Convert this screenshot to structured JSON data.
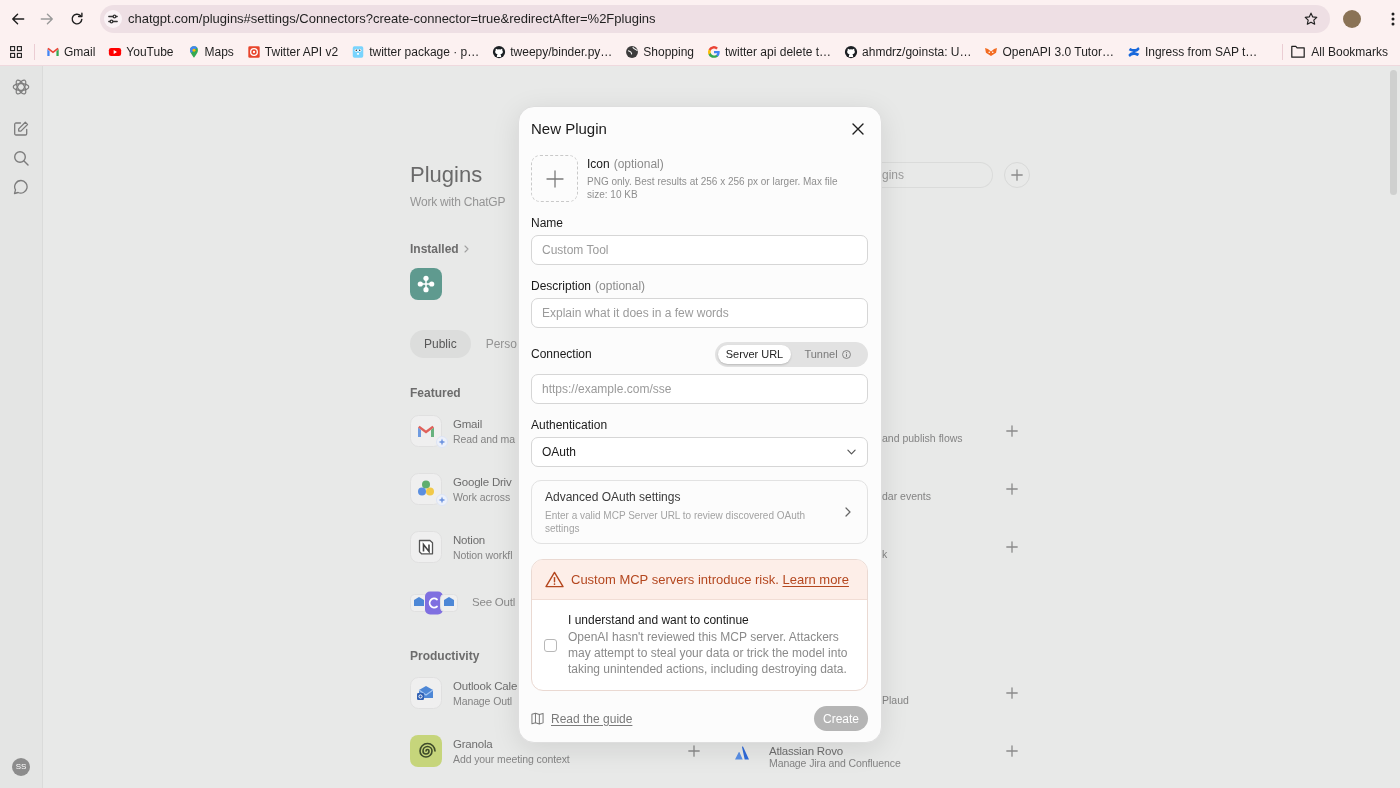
{
  "browser": {
    "url": "chatgpt.com/plugins#settings/Connectors?create-connector=true&redirectAfter=%2Fplugins",
    "bookmarks": [
      {
        "label": "Gmail"
      },
      {
        "label": "YouTube"
      },
      {
        "label": "Maps"
      },
      {
        "label": "Twitter API v2"
      },
      {
        "label": "twitter package · p…"
      },
      {
        "label": "tweepy/binder.py…"
      },
      {
        "label": "Shopping"
      },
      {
        "label": "twitter api delete t…"
      },
      {
        "label": "ahmdrz/goinsta: U…"
      },
      {
        "label": "OpenAPI 3.0 Tutor…"
      },
      {
        "label": "Ingress from SAP t…"
      }
    ],
    "all_bookmarks": "All Bookmarks"
  },
  "sidebar": {
    "avatar_initials": "SS"
  },
  "plugins_page": {
    "title": "Plugins",
    "subtitle": "Work with ChatGP",
    "search": {
      "placeholder": "gins"
    },
    "installed": {
      "label": "Installed"
    },
    "tabs": [
      {
        "label": "Public",
        "selected": true
      },
      {
        "label": "Perso",
        "selected": false
      }
    ],
    "sections": [
      {
        "title": "Featured",
        "rows": [
          {
            "kind": "app",
            "name": "Gmail",
            "description": "Read and ma",
            "right_description": "and publish flows"
          },
          {
            "kind": "app",
            "name": "Google Driv",
            "description": "Work across",
            "right_description": "dar events"
          },
          {
            "kind": "app",
            "name": "Notion",
            "description": "Notion workfl",
            "right_description": "k"
          },
          {
            "kind": "more",
            "label": "See Outl"
          }
        ]
      },
      {
        "title": "Productivity",
        "rows": [
          {
            "kind": "app",
            "name": "Outlook Cale",
            "description": "Manage Outl",
            "right_description": "Plaud"
          },
          {
            "kind": "pair",
            "left": {
              "name": "Granola",
              "description": "Add your meeting context"
            },
            "right": {
              "name": "Atlassian Rovo",
              "description": "Manage Jira and Confluence"
            }
          }
        ]
      }
    ]
  },
  "modal": {
    "title": "New Plugin",
    "icon_upload": {
      "label": "Icon",
      "optional": "(optional)",
      "hint": "PNG only. Best results at 256 x 256 px or larger. Max file size: 10 KB"
    },
    "fields": [
      {
        "kind": "text",
        "label": "Name",
        "placeholder": "Custom Tool"
      },
      {
        "kind": "text",
        "label": "Description",
        "optional": "(optional)",
        "placeholder": "Explain what it does in a few words"
      },
      {
        "kind": "connection",
        "label": "Connection",
        "options": [
          {
            "label": "Server URL",
            "selected": true,
            "info_icon": false
          },
          {
            "label": "Tunnel",
            "selected": false,
            "info_icon": true
          }
        ],
        "placeholder": "https://example.com/sse"
      },
      {
        "kind": "select",
        "label": "Authentication",
        "value": "OAuth"
      }
    ],
    "advanced": {
      "title": "Advanced OAuth settings",
      "hint": "Enter a valid MCP Server URL to review discovered OAuth settings"
    },
    "warning": {
      "text": "Custom MCP servers introduce risk.",
      "link": "Learn more"
    },
    "consent": {
      "title": "I understand and want to continue",
      "text": "OpenAI hasn't reviewed this MCP server. Attackers may attempt to steal your data or trick the model into taking unintended actions, including destroying data.",
      "checked": false
    },
    "footer": {
      "guide_link": "Read the guide",
      "create": "Create",
      "create_disabled": true
    }
  }
}
